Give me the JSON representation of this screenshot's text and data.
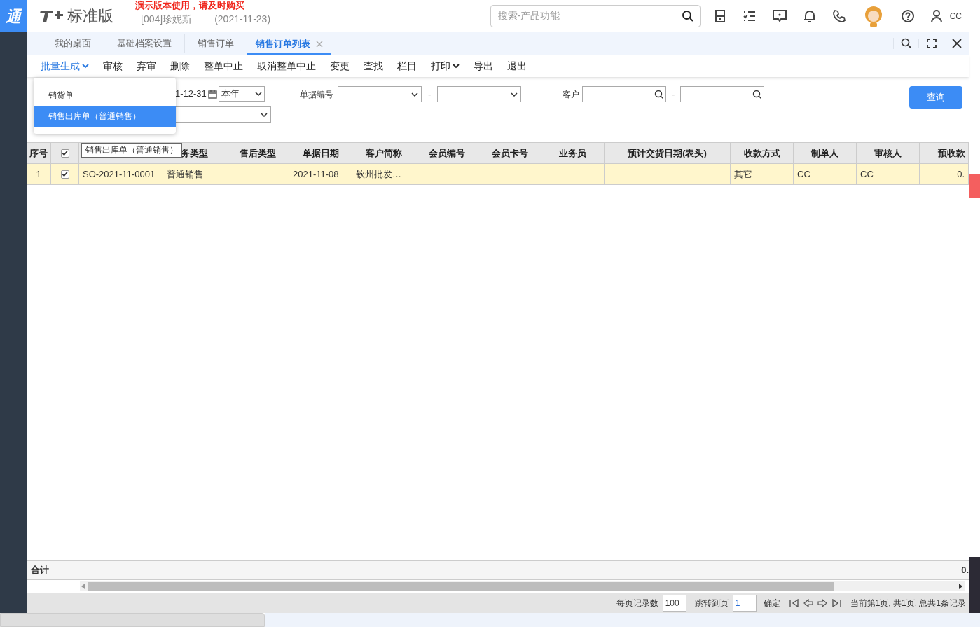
{
  "sidebar": {
    "logo": "通"
  },
  "header": {
    "product": "标准版",
    "notice": "演示版本使用，请及时购买",
    "account": "[004]珍妮斯",
    "date": "(2021-11-23)",
    "search": {
      "placeholder": "搜索-产品功能"
    },
    "user": "CC"
  },
  "tabs": [
    {
      "label": "我的桌面",
      "selected": false,
      "closable": false
    },
    {
      "label": "基础档案设置",
      "selected": false,
      "closable": false
    },
    {
      "label": "销售订单",
      "selected": false,
      "closable": false
    },
    {
      "label": "销售订单列表",
      "selected": true,
      "closable": true
    }
  ],
  "toolbar": [
    {
      "label": "批量生成",
      "menu": true,
      "active": true
    },
    {
      "label": "审核",
      "menu": false,
      "active": false
    },
    {
      "label": "弃审",
      "menu": false,
      "active": false
    },
    {
      "label": "删除",
      "menu": false,
      "active": false
    },
    {
      "label": "整单中止",
      "menu": false,
      "active": false
    },
    {
      "label": "取消整单中止",
      "menu": false,
      "active": false
    },
    {
      "label": "变更",
      "menu": false,
      "active": false
    },
    {
      "label": "查找",
      "menu": false,
      "active": false
    },
    {
      "label": "栏目",
      "menu": false,
      "active": false
    },
    {
      "label": "打印",
      "menu": true,
      "active": false
    },
    {
      "label": "导出",
      "menu": false,
      "active": false
    },
    {
      "label": "退出",
      "menu": false,
      "active": false
    }
  ],
  "dropdown": [
    {
      "label": "销货单",
      "selected": false
    },
    {
      "label": "销售出库单（普通销售）",
      "selected": true
    }
  ],
  "filters": {
    "date_end": "1-12-31",
    "period": "本年",
    "doc_no_label": "单据编号",
    "range_sep": "-",
    "customer_label": "客户",
    "query_button": "查询"
  },
  "tooltip": "销售出库单（普通销售）",
  "table": {
    "columns": [
      {
        "kind": "text",
        "label": "序号"
      },
      {
        "kind": "checkbox",
        "checked": true
      },
      {
        "kind": "text"
      },
      {
        "kind": "text",
        "label": "务类型"
      },
      {
        "kind": "text",
        "label": "售后类型"
      },
      {
        "kind": "text",
        "label": "单据日期"
      },
      {
        "kind": "text",
        "label": "客户简称"
      },
      {
        "kind": "text",
        "label": "会员编号"
      },
      {
        "kind": "text",
        "label": "会员卡号"
      },
      {
        "kind": "text",
        "label": "业务员"
      },
      {
        "kind": "text",
        "label": "预计交货日期(表头)"
      },
      {
        "kind": "text",
        "label": "收款方式"
      },
      {
        "kind": "text",
        "label": "制单人"
      },
      {
        "kind": "text",
        "label": "审核人"
      },
      {
        "kind": "text",
        "label": "预收款"
      }
    ],
    "rows": [
      {
        "seq": "1",
        "checked": true,
        "doc_no": "SO-2021-11-0001",
        "business_type": "普通销售",
        "doc_date": "2021-11-08",
        "customer": "钦州批发…",
        "payment": "其它",
        "creator": "CC",
        "reviewer": "CC",
        "prepay": "0."
      }
    ],
    "total": {
      "label": "合计",
      "value": "0."
    }
  },
  "pager": {
    "page_size_label": "每页记录数",
    "page_size": "100",
    "goto_label": "跳转到页",
    "page": "1",
    "confirm": "确定",
    "summary": "当前第1页, 共1页, 总共1条记录"
  }
}
